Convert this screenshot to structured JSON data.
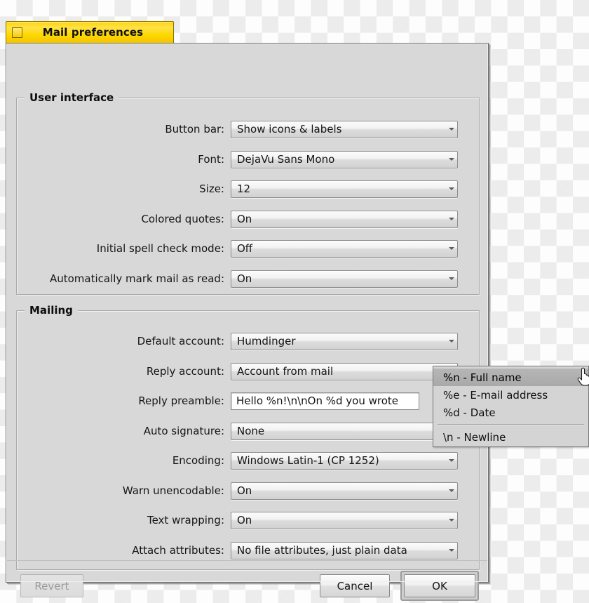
{
  "window": {
    "title": "Mail preferences",
    "widget_icon": "window-zoom-square-icon"
  },
  "sections": {
    "user_interface": {
      "legend": "User interface",
      "rows": [
        {
          "label": "Button bar:",
          "value": "Show icons & labels",
          "control": "dropdown"
        },
        {
          "label": "Font:",
          "value": "DejaVu Sans Mono",
          "control": "dropdown"
        },
        {
          "label": "Size:",
          "value": "12",
          "control": "dropdown"
        },
        {
          "label": "Colored quotes:",
          "value": "On",
          "control": "dropdown"
        },
        {
          "label": "Initial spell check mode:",
          "value": "Off",
          "control": "dropdown"
        },
        {
          "label": "Automatically mark mail as read:",
          "value": "On",
          "control": "dropdown"
        }
      ]
    },
    "mailing": {
      "legend": "Mailing",
      "rows": [
        {
          "label": "Default account:",
          "value": "Humdinger",
          "control": "dropdown"
        },
        {
          "label": "Reply account:",
          "value": "Account from mail",
          "control": "dropdown"
        },
        {
          "label": "Reply preamble:",
          "value": "Hello %n!\\n\\nOn %d you wrote",
          "control": "textfield"
        },
        {
          "label": "Auto signature:",
          "value": "None",
          "control": "dropdown"
        },
        {
          "label": "Encoding:",
          "value": "Windows Latin-1 (CP 1252)",
          "control": "dropdown"
        },
        {
          "label": "Warn unencodable:",
          "value": "On",
          "control": "dropdown"
        },
        {
          "label": "Text wrapping:",
          "value": "On",
          "control": "dropdown"
        },
        {
          "label": "Attach attributes:",
          "value": "No file attributes, just plain data",
          "control": "dropdown"
        }
      ]
    }
  },
  "popup_menu": {
    "items": [
      {
        "label": "%n - Full name",
        "selected": true
      },
      {
        "label": "%e - E-mail address",
        "selected": false
      },
      {
        "label": "%d - Date",
        "selected": false
      },
      {
        "label": "separator",
        "separator": true
      },
      {
        "label": "\\n - Newline",
        "selected": false
      }
    ]
  },
  "buttons": {
    "revert": "Revert",
    "cancel": "Cancel",
    "ok": "OK"
  },
  "colors": {
    "titlebar_yellow": "#ffd400",
    "window_bg": "#d8d8d8",
    "menu_highlight": "#b0b0b0"
  }
}
